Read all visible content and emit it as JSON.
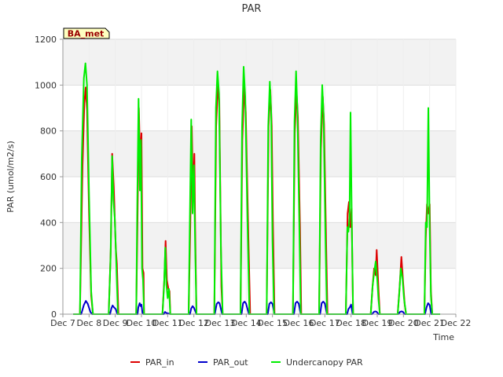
{
  "chart_data": {
    "type": "line",
    "title": "PAR",
    "xlabel": "Time",
    "ylabel": "PAR (umol/m2/s)",
    "badge": "BA_met",
    "xlim": [
      7,
      22
    ],
    "ylim": [
      0,
      1200
    ],
    "x_tick_values": [
      7,
      8,
      9,
      10,
      11,
      12,
      13,
      14,
      15,
      16,
      17,
      18,
      19,
      20,
      21,
      22
    ],
    "x_tick_labels": [
      "Dec 7",
      "Dec 8",
      "Dec 9",
      "Dec 10",
      "Dec 11",
      "Dec 12",
      "Dec 13",
      "Dec 14",
      "Dec 15",
      "Dec 16",
      "Dec 17",
      "Dec 18",
      "Dec 19",
      "Dec 20",
      "Dec 21",
      "Dec 22"
    ],
    "y_ticks": [
      0,
      200,
      400,
      600,
      800,
      1000,
      1200
    ],
    "grid": true,
    "legend_position": "bottom",
    "series": [
      {
        "name": "PAR_in",
        "color": "#dd0000",
        "points": [
          [
            7.4,
            0
          ],
          [
            7.65,
            0
          ],
          [
            7.75,
            650
          ],
          [
            7.82,
            920
          ],
          [
            7.87,
            990
          ],
          [
            7.92,
            890
          ],
          [
            8.0,
            440
          ],
          [
            8.08,
            80
          ],
          [
            8.15,
            0
          ],
          [
            8.75,
            0
          ],
          [
            8.83,
            290
          ],
          [
            8.88,
            700
          ],
          [
            8.94,
            560
          ],
          [
            9.02,
            290
          ],
          [
            9.06,
            220
          ],
          [
            9.12,
            0
          ],
          [
            9.8,
            0
          ],
          [
            9.85,
            420
          ],
          [
            9.9,
            900
          ],
          [
            9.95,
            660
          ],
          [
            10.0,
            790
          ],
          [
            10.04,
            200
          ],
          [
            10.08,
            180
          ],
          [
            10.1,
            0
          ],
          [
            10.8,
            0
          ],
          [
            10.87,
            150
          ],
          [
            10.92,
            320
          ],
          [
            10.97,
            150
          ],
          [
            11.03,
            110
          ],
          [
            11.07,
            100
          ],
          [
            11.1,
            0
          ],
          [
            11.8,
            0
          ],
          [
            11.87,
            420
          ],
          [
            11.92,
            820
          ],
          [
            11.97,
            500
          ],
          [
            12.02,
            700
          ],
          [
            12.05,
            380
          ],
          [
            12.1,
            0
          ],
          [
            12.78,
            0
          ],
          [
            12.85,
            820
          ],
          [
            12.92,
            1000
          ],
          [
            12.97,
            930
          ],
          [
            13.05,
            120
          ],
          [
            13.1,
            0
          ],
          [
            13.78,
            0
          ],
          [
            13.85,
            760
          ],
          [
            13.92,
            990
          ],
          [
            13.98,
            880
          ],
          [
            14.08,
            340
          ],
          [
            14.15,
            0
          ],
          [
            14.78,
            0
          ],
          [
            14.85,
            820
          ],
          [
            14.92,
            980
          ],
          [
            14.97,
            820
          ],
          [
            15.02,
            390
          ],
          [
            15.08,
            0
          ],
          [
            15.78,
            0
          ],
          [
            15.85,
            790
          ],
          [
            15.92,
            970
          ],
          [
            15.97,
            860
          ],
          [
            16.05,
            380
          ],
          [
            16.1,
            0
          ],
          [
            16.78,
            0
          ],
          [
            16.85,
            720
          ],
          [
            16.92,
            950
          ],
          [
            16.97,
            830
          ],
          [
            17.05,
            300
          ],
          [
            17.1,
            0
          ],
          [
            17.8,
            0
          ],
          [
            17.87,
            440
          ],
          [
            17.92,
            490
          ],
          [
            17.97,
            380
          ],
          [
            18.02,
            460
          ],
          [
            18.08,
            0
          ],
          [
            18.75,
            0
          ],
          [
            18.82,
            120
          ],
          [
            18.88,
            200
          ],
          [
            18.94,
            170
          ],
          [
            18.98,
            280
          ],
          [
            19.05,
            100
          ],
          [
            19.1,
            0
          ],
          [
            19.78,
            0
          ],
          [
            19.85,
            110
          ],
          [
            19.92,
            250
          ],
          [
            19.98,
            150
          ],
          [
            20.05,
            40
          ],
          [
            20.1,
            0
          ],
          [
            20.8,
            0
          ],
          [
            20.85,
            330
          ],
          [
            20.9,
            480
          ],
          [
            20.95,
            440
          ],
          [
            21.0,
            480
          ],
          [
            21.05,
            100
          ],
          [
            21.1,
            0
          ],
          [
            21.4,
            0
          ]
        ]
      },
      {
        "name": "PAR_out",
        "color": "#0000cc",
        "points": [
          [
            7.4,
            0
          ],
          [
            7.7,
            0
          ],
          [
            7.8,
            40
          ],
          [
            7.88,
            58
          ],
          [
            7.95,
            45
          ],
          [
            8.05,
            10
          ],
          [
            8.12,
            0
          ],
          [
            8.8,
            0
          ],
          [
            8.85,
            25
          ],
          [
            8.9,
            38
          ],
          [
            8.95,
            30
          ],
          [
            9.02,
            22
          ],
          [
            9.08,
            0
          ],
          [
            9.85,
            0
          ],
          [
            9.88,
            30
          ],
          [
            9.93,
            48
          ],
          [
            9.97,
            35
          ],
          [
            10.0,
            42
          ],
          [
            10.04,
            5
          ],
          [
            10.08,
            0
          ],
          [
            10.85,
            0
          ],
          [
            10.9,
            10
          ],
          [
            10.95,
            5
          ],
          [
            11.02,
            3
          ],
          [
            11.1,
            0
          ],
          [
            11.85,
            0
          ],
          [
            11.9,
            25
          ],
          [
            11.95,
            35
          ],
          [
            12.0,
            28
          ],
          [
            12.05,
            15
          ],
          [
            12.1,
            0
          ],
          [
            12.8,
            0
          ],
          [
            12.87,
            45
          ],
          [
            12.93,
            52
          ],
          [
            12.98,
            48
          ],
          [
            13.08,
            0
          ],
          [
            13.82,
            0
          ],
          [
            13.88,
            48
          ],
          [
            13.94,
            55
          ],
          [
            13.99,
            47
          ],
          [
            14.1,
            0
          ],
          [
            14.82,
            0
          ],
          [
            14.88,
            45
          ],
          [
            14.94,
            52
          ],
          [
            15.0,
            45
          ],
          [
            15.08,
            0
          ],
          [
            15.82,
            0
          ],
          [
            15.88,
            48
          ],
          [
            15.94,
            55
          ],
          [
            16.0,
            47
          ],
          [
            16.08,
            0
          ],
          [
            16.82,
            0
          ],
          [
            16.88,
            48
          ],
          [
            16.94,
            55
          ],
          [
            17.0,
            47
          ],
          [
            17.08,
            0
          ],
          [
            17.85,
            0
          ],
          [
            17.9,
            22
          ],
          [
            17.95,
            30
          ],
          [
            18.0,
            42
          ],
          [
            18.06,
            0
          ],
          [
            18.8,
            0
          ],
          [
            18.87,
            10
          ],
          [
            18.93,
            12
          ],
          [
            18.98,
            10
          ],
          [
            19.05,
            0
          ],
          [
            19.8,
            0
          ],
          [
            19.87,
            10
          ],
          [
            19.93,
            12
          ],
          [
            19.98,
            10
          ],
          [
            20.05,
            0
          ],
          [
            20.82,
            0
          ],
          [
            20.88,
            30
          ],
          [
            20.94,
            48
          ],
          [
            21.0,
            40
          ],
          [
            21.06,
            0
          ],
          [
            21.4,
            0
          ]
        ]
      },
      {
        "name": "Undercanopy PAR",
        "color": "#00ee00",
        "points": [
          [
            7.4,
            0
          ],
          [
            7.65,
            0
          ],
          [
            7.72,
            680
          ],
          [
            7.8,
            1030
          ],
          [
            7.86,
            1095
          ],
          [
            7.92,
            1000
          ],
          [
            8.0,
            520
          ],
          [
            8.08,
            100
          ],
          [
            8.15,
            0
          ],
          [
            8.75,
            0
          ],
          [
            8.82,
            250
          ],
          [
            8.88,
            690
          ],
          [
            8.93,
            500
          ],
          [
            8.98,
            420
          ],
          [
            9.03,
            250
          ],
          [
            9.1,
            0
          ],
          [
            9.8,
            0
          ],
          [
            9.84,
            500
          ],
          [
            9.89,
            940
          ],
          [
            9.94,
            540
          ],
          [
            9.98,
            760
          ],
          [
            10.02,
            200
          ],
          [
            10.06,
            150
          ],
          [
            10.1,
            0
          ],
          [
            10.8,
            0
          ],
          [
            10.86,
            120
          ],
          [
            10.91,
            290
          ],
          [
            10.95,
            130
          ],
          [
            11.0,
            70
          ],
          [
            11.05,
            110
          ],
          [
            11.1,
            0
          ],
          [
            11.8,
            0
          ],
          [
            11.85,
            450
          ],
          [
            11.9,
            850
          ],
          [
            11.95,
            440
          ],
          [
            12.0,
            650
          ],
          [
            12.05,
            300
          ],
          [
            12.1,
            0
          ],
          [
            12.78,
            0
          ],
          [
            12.84,
            900
          ],
          [
            12.9,
            1060
          ],
          [
            12.96,
            960
          ],
          [
            13.03,
            300
          ],
          [
            13.1,
            0
          ],
          [
            13.78,
            0
          ],
          [
            13.84,
            820
          ],
          [
            13.9,
            1080
          ],
          [
            13.96,
            950
          ],
          [
            14.05,
            380
          ],
          [
            14.12,
            0
          ],
          [
            14.78,
            0
          ],
          [
            14.84,
            820
          ],
          [
            14.9,
            1015
          ],
          [
            14.95,
            880
          ],
          [
            15.0,
            320
          ],
          [
            15.06,
            0
          ],
          [
            15.78,
            0
          ],
          [
            15.84,
            840
          ],
          [
            15.9,
            1060
          ],
          [
            15.95,
            900
          ],
          [
            16.02,
            420
          ],
          [
            16.08,
            0
          ],
          [
            16.78,
            0
          ],
          [
            16.84,
            760
          ],
          [
            16.9,
            1000
          ],
          [
            16.95,
            870
          ],
          [
            17.02,
            350
          ],
          [
            17.08,
            0
          ],
          [
            17.8,
            0
          ],
          [
            17.86,
            380
          ],
          [
            17.9,
            360
          ],
          [
            17.94,
            420
          ],
          [
            17.98,
            880
          ],
          [
            18.03,
            380
          ],
          [
            18.08,
            0
          ],
          [
            18.75,
            0
          ],
          [
            18.82,
            120
          ],
          [
            18.88,
            180
          ],
          [
            18.94,
            230
          ],
          [
            19.0,
            150
          ],
          [
            19.05,
            60
          ],
          [
            19.1,
            0
          ],
          [
            19.78,
            0
          ],
          [
            19.84,
            90
          ],
          [
            19.9,
            200
          ],
          [
            19.96,
            160
          ],
          [
            20.02,
            70
          ],
          [
            20.1,
            0
          ],
          [
            20.8,
            0
          ],
          [
            20.85,
            400
          ],
          [
            20.9,
            380
          ],
          [
            20.95,
            900
          ],
          [
            21.0,
            380
          ],
          [
            21.05,
            80
          ],
          [
            21.1,
            0
          ],
          [
            21.4,
            0
          ]
        ]
      }
    ]
  }
}
